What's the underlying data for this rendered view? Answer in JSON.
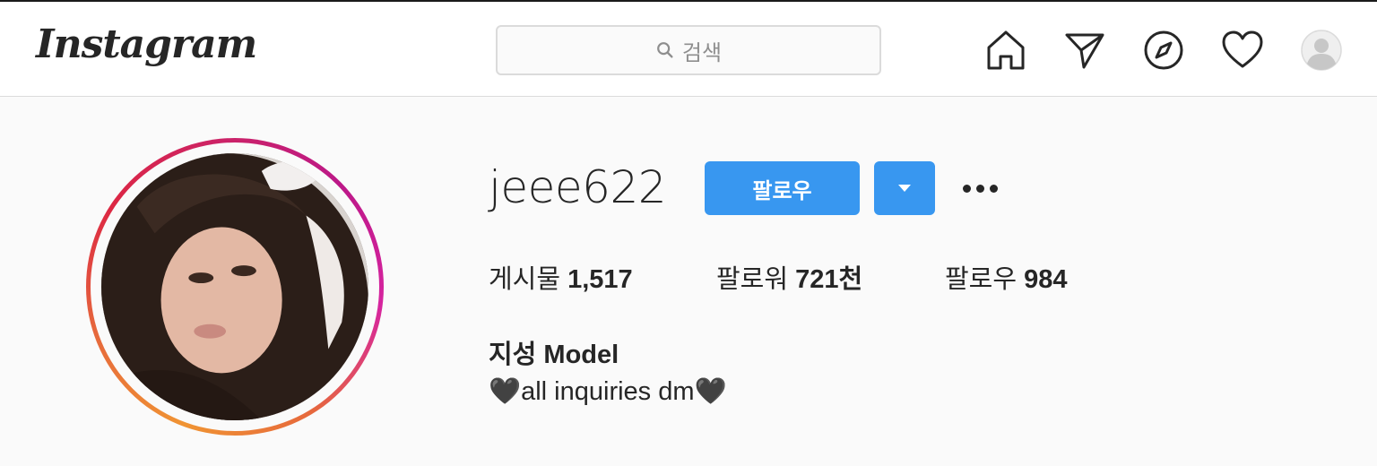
{
  "header": {
    "logo_text": "Instagram",
    "search_placeholder": "검색",
    "icons": [
      "home-icon",
      "direct-message-icon",
      "explore-icon",
      "activity-heart-icon",
      "profile-avatar-icon"
    ]
  },
  "profile": {
    "username": "jeee622",
    "follow_label": "팔로우",
    "stats": {
      "posts_label": "게시물",
      "posts_value": "1,517",
      "followers_label": "팔로워",
      "followers_value": "721천",
      "following_label": "팔로우",
      "following_value": "984"
    },
    "full_name": "지성 Model",
    "bio": "🖤all inquiries dm🖤"
  },
  "colors": {
    "accent_blue": "#3897f0",
    "text_primary": "#262626",
    "border": "#dbdbdb",
    "background": "#fafafa"
  }
}
